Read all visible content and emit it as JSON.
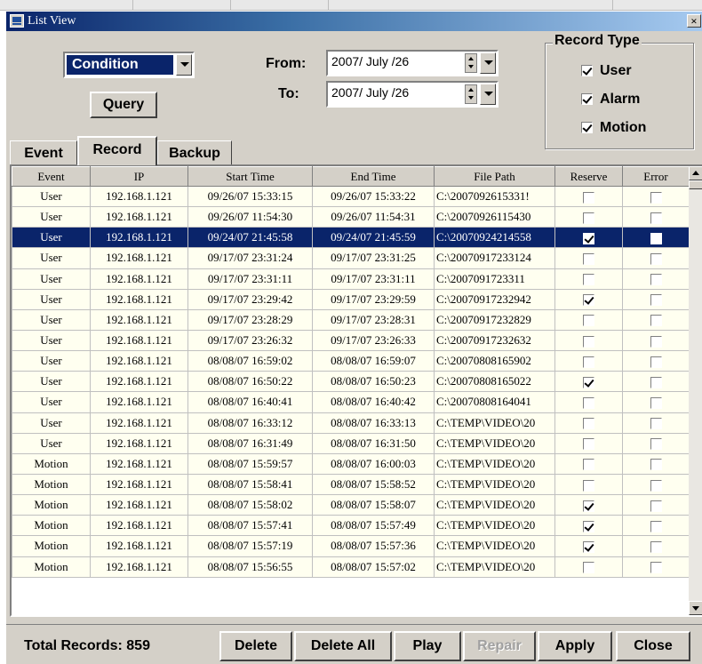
{
  "window": {
    "title": "List View",
    "close_label": "×"
  },
  "filter": {
    "condition": "Condition",
    "query_label": "Query",
    "from_label": "From:",
    "to_label": "To:",
    "from_date": "2007/  July  /26",
    "to_date": "2007/  July  /26"
  },
  "record_type": {
    "title": "Record Type",
    "items": [
      {
        "label": "User",
        "checked": true
      },
      {
        "label": "Alarm",
        "checked": true
      },
      {
        "label": "Motion",
        "checked": true
      }
    ]
  },
  "tabs": [
    {
      "label": "Event",
      "active": false
    },
    {
      "label": "Record",
      "active": true
    },
    {
      "label": "Backup",
      "active": false
    }
  ],
  "table": {
    "columns": [
      "Event",
      "IP",
      "Start Time",
      "End Time",
      "File Path",
      "Reserve",
      "Error"
    ],
    "selected_row": 2,
    "rows": [
      {
        "event": "User",
        "ip": "192.168.1.121",
        "start": "09/26/07 15:33:15",
        "end": "09/26/07 15:33:22",
        "path": "C:\\2007092615331!",
        "reserve": false,
        "error": false
      },
      {
        "event": "User",
        "ip": "192.168.1.121",
        "start": "09/26/07 11:54:30",
        "end": "09/26/07 11:54:31",
        "path": "C:\\20070926115430",
        "reserve": false,
        "error": false
      },
      {
        "event": "User",
        "ip": "192.168.1.121",
        "start": "09/24/07 21:45:58",
        "end": "09/24/07 21:45:59",
        "path": "C:\\20070924214558",
        "reserve": true,
        "error": false
      },
      {
        "event": "User",
        "ip": "192.168.1.121",
        "start": "09/17/07 23:31:24",
        "end": "09/17/07 23:31:25",
        "path": "C:\\20070917233124",
        "reserve": false,
        "error": false
      },
      {
        "event": "User",
        "ip": "192.168.1.121",
        "start": "09/17/07 23:31:11",
        "end": "09/17/07 23:31:11",
        "path": "C:\\2007091723311",
        "reserve": false,
        "error": false
      },
      {
        "event": "User",
        "ip": "192.168.1.121",
        "start": "09/17/07 23:29:42",
        "end": "09/17/07 23:29:59",
        "path": "C:\\20070917232942",
        "reserve": true,
        "error": false
      },
      {
        "event": "User",
        "ip": "192.168.1.121",
        "start": "09/17/07 23:28:29",
        "end": "09/17/07 23:28:31",
        "path": "C:\\20070917232829",
        "reserve": false,
        "error": false
      },
      {
        "event": "User",
        "ip": "192.168.1.121",
        "start": "09/17/07 23:26:32",
        "end": "09/17/07 23:26:33",
        "path": "C:\\20070917232632",
        "reserve": false,
        "error": false
      },
      {
        "event": "User",
        "ip": "192.168.1.121",
        "start": "08/08/07 16:59:02",
        "end": "08/08/07 16:59:07",
        "path": "C:\\20070808165902",
        "reserve": false,
        "error": false
      },
      {
        "event": "User",
        "ip": "192.168.1.121",
        "start": "08/08/07 16:50:22",
        "end": "08/08/07 16:50:23",
        "path": "C:\\20070808165022",
        "reserve": true,
        "error": false
      },
      {
        "event": "User",
        "ip": "192.168.1.121",
        "start": "08/08/07 16:40:41",
        "end": "08/08/07 16:40:42",
        "path": "C:\\20070808164041",
        "reserve": false,
        "error": false
      },
      {
        "event": "User",
        "ip": "192.168.1.121",
        "start": "08/08/07 16:33:12",
        "end": "08/08/07 16:33:13",
        "path": "C:\\TEMP\\VIDEO\\20",
        "reserve": false,
        "error": false
      },
      {
        "event": "User",
        "ip": "192.168.1.121",
        "start": "08/08/07 16:31:49",
        "end": "08/08/07 16:31:50",
        "path": "C:\\TEMP\\VIDEO\\20",
        "reserve": false,
        "error": false
      },
      {
        "event": "Motion",
        "ip": "192.168.1.121",
        "start": "08/08/07 15:59:57",
        "end": "08/08/07 16:00:03",
        "path": "C:\\TEMP\\VIDEO\\20",
        "reserve": false,
        "error": false
      },
      {
        "event": "Motion",
        "ip": "192.168.1.121",
        "start": "08/08/07 15:58:41",
        "end": "08/08/07 15:58:52",
        "path": "C:\\TEMP\\VIDEO\\20",
        "reserve": false,
        "error": false
      },
      {
        "event": "Motion",
        "ip": "192.168.1.121",
        "start": "08/08/07 15:58:02",
        "end": "08/08/07 15:58:07",
        "path": "C:\\TEMP\\VIDEO\\20",
        "reserve": true,
        "error": false
      },
      {
        "event": "Motion",
        "ip": "192.168.1.121",
        "start": "08/08/07 15:57:41",
        "end": "08/08/07 15:57:49",
        "path": "C:\\TEMP\\VIDEO\\20",
        "reserve": true,
        "error": false
      },
      {
        "event": "Motion",
        "ip": "192.168.1.121",
        "start": "08/08/07 15:57:19",
        "end": "08/08/07 15:57:36",
        "path": "C:\\TEMP\\VIDEO\\20",
        "reserve": true,
        "error": false
      },
      {
        "event": "Motion",
        "ip": "192.168.1.121",
        "start": "08/08/07 15:56:55",
        "end": "08/08/07 15:57:02",
        "path": "C:\\TEMP\\VIDEO\\20",
        "reserve": false,
        "error": false
      }
    ]
  },
  "footer": {
    "total_label": "Total Records:",
    "total_value": "859",
    "buttons": [
      {
        "label": "Delete",
        "enabled": true
      },
      {
        "label": "Delete All",
        "enabled": true
      },
      {
        "label": "Play",
        "enabled": true
      },
      {
        "label": "Repair",
        "enabled": false
      },
      {
        "label": "Apply",
        "enabled": true
      },
      {
        "label": "Close",
        "enabled": true
      }
    ]
  },
  "colors": {
    "selection": "#0a246a",
    "row_bg": "#fffff0",
    "face": "#d4d0c8"
  }
}
